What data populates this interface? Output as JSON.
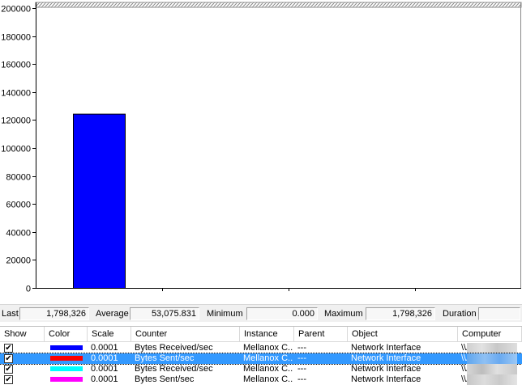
{
  "chart_data": {
    "type": "bar",
    "ylim": [
      0,
      200000
    ],
    "yticks": [
      "0",
      "20000",
      "40000",
      "60000",
      "80000",
      "100000",
      "120000",
      "140000",
      "160000",
      "180000",
      "200000"
    ],
    "values": [
      124500
    ],
    "bar_color": "#0000ff"
  },
  "stats": {
    "last_label": "Last",
    "last_value": "1,798,326",
    "average_label": "Average",
    "average_value": "53,075.831",
    "minimum_label": "Minimum",
    "minimum_value": "0.000",
    "maximum_label": "Maximum",
    "maximum_value": "1,798,326",
    "duration_label": "Duration",
    "duration_value": ""
  },
  "table": {
    "headers": [
      "Show",
      "Color",
      "Scale",
      "Counter",
      "Instance",
      "Parent",
      "Object",
      "Computer"
    ],
    "rows": [
      {
        "show": "✔",
        "color": "#0000ff",
        "scale": "0.0001",
        "counter": "Bytes Received/sec",
        "instance": "Mellanox C...",
        "parent": "---",
        "object": "Network Interface",
        "computer": "\\\\A"
      },
      {
        "show": "✔",
        "color": "#ff0000",
        "scale": "0.0001",
        "counter": "Bytes Sent/sec",
        "instance": "Mellanox C...",
        "parent": "---",
        "object": "Network Interface",
        "computer": "\\\\A"
      },
      {
        "show": "✔",
        "color": "#00ffff",
        "scale": "0.0001",
        "counter": "Bytes Received/sec",
        "instance": "Mellanox C...",
        "parent": "---",
        "object": "Network Interface",
        "computer": "\\\\A"
      },
      {
        "show": "✔",
        "color": "#ff00ff",
        "scale": "0.0001",
        "counter": "Bytes Sent/sec",
        "instance": "Mellanox C...",
        "parent": "---",
        "object": "Network Interface",
        "computer": "\\\\A"
      }
    ]
  }
}
